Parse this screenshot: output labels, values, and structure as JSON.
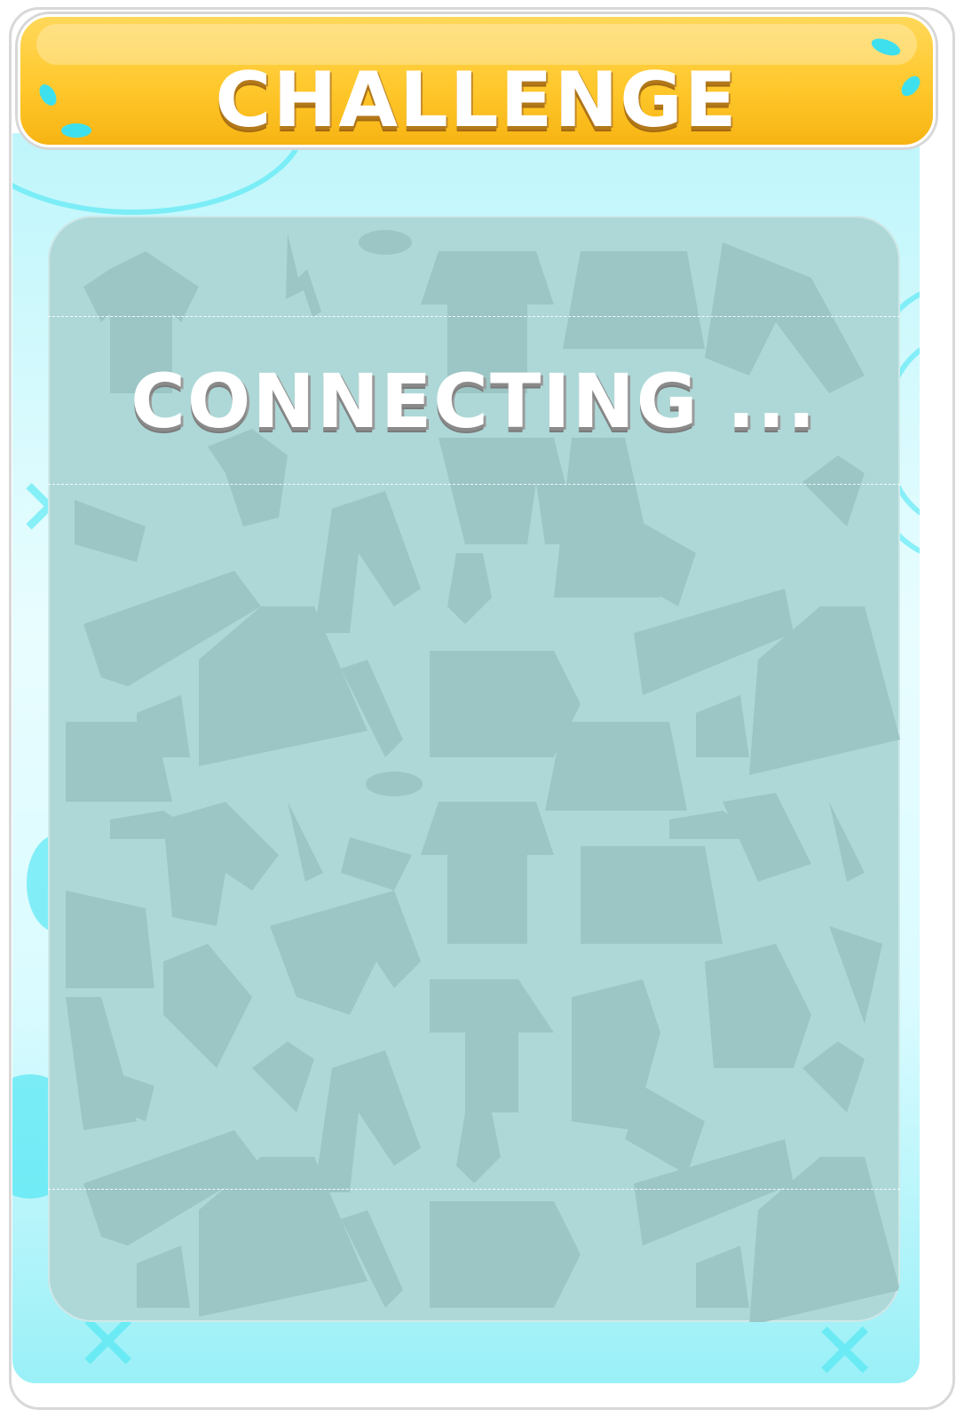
{
  "header": {
    "title": "CHALLENGE"
  },
  "panel": {
    "status": "CONNECTING ..."
  },
  "colors": {
    "header_top": "#ffd85a",
    "header_bottom": "#f7b413",
    "panel": "#aed8d8",
    "pattern": "#9cc5c5",
    "accent_cyan": "#3fe6f2"
  },
  "icons": [
    "clothing-pattern-icon",
    "water-splash-icon"
  ]
}
